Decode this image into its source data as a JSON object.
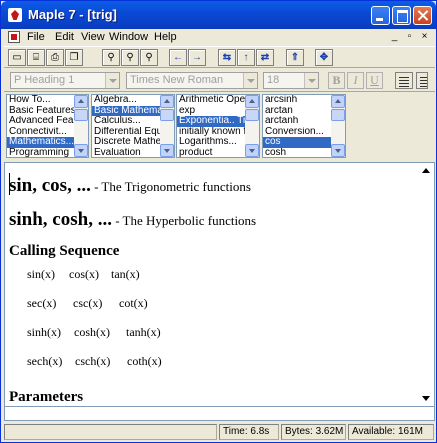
{
  "window": {
    "title": "Maple 7 - [trig]"
  },
  "menu": {
    "items": [
      "File",
      "Edit",
      "View",
      "Window",
      "Help"
    ],
    "mdi": [
      "_",
      "▫",
      "×"
    ]
  },
  "toolbar": {
    "buttons": [
      "new-icon",
      "open-icon",
      "print-icon",
      "copy-icon",
      "zoom-100-icon",
      "zoom-200-icon",
      "zoom-300-icon",
      "back-arrow-icon",
      "forward-arrow-icon",
      "restart-icon",
      "stop-icon",
      "spell-icon",
      "up-icon",
      "expand-icon"
    ]
  },
  "context": {
    "style": "P Heading 1",
    "font": "Times New Roman",
    "size": "18",
    "bold": "B",
    "italic": "I",
    "underline": "U"
  },
  "browser": {
    "col1": {
      "items": [
        "How To...",
        "Basic Features",
        "Advanced Fea",
        "Connectivit...",
        "Mathematics...",
        "Programming"
      ],
      "selected": 4
    },
    "col2": {
      "items": [
        "Algebra...",
        "Basic Mathema",
        "Calculus...",
        "Differential Equ",
        "Discrete Mathe",
        "Evaluation"
      ],
      "selected": 1
    },
    "col3": {
      "items": [
        "Arithmetic Oper",
        "exp",
        "Exponentia.. Tr",
        "initially known f",
        "Logarithms...",
        "product"
      ],
      "selected": 2
    },
    "col4": {
      "items": [
        "arcsinh",
        "arctan",
        "arctanh",
        "Conversion...",
        "cos",
        "cosh"
      ],
      "selected": 4
    }
  },
  "document": {
    "heading1": {
      "funcs": "sin, cos, ...",
      "desc": " - The Trigonometric functions"
    },
    "heading2": {
      "funcs": "sinh, cosh, ...",
      "desc": " - The Hyperbolic functions"
    },
    "calling_sequence_title": "Calling Sequence",
    "rows": [
      [
        "sin(x)",
        "cos(x)",
        "tan(x)"
      ],
      [
        "sec(x)",
        "csc(x)",
        "cot(x)"
      ],
      [
        "sinh(x)",
        "cosh(x)",
        "tanh(x)"
      ],
      [
        "sech(x)",
        "csch(x)",
        "coth(x)"
      ]
    ],
    "parameters_title": "Parameters"
  },
  "status": {
    "time": "Time:   6.8s",
    "bytes": "Bytes: 3.62M",
    "available": "Available: 161M"
  }
}
